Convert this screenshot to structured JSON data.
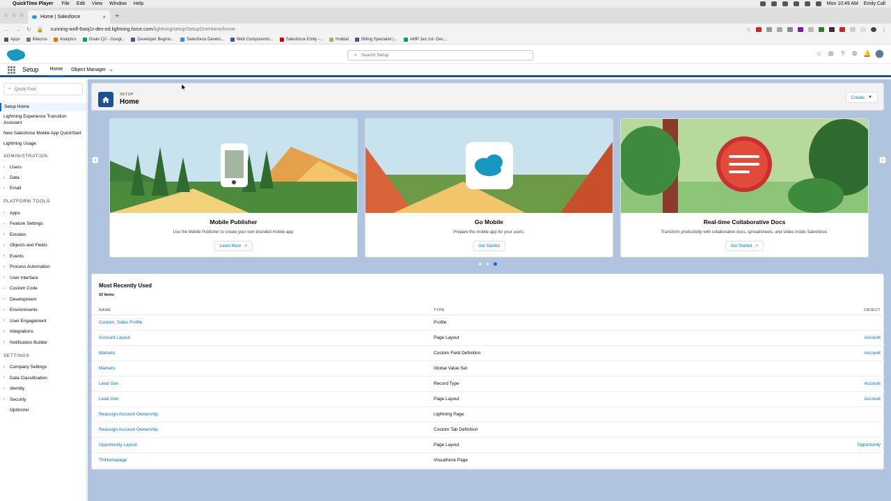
{
  "menubar": {
    "app_name": "QuickTime Player",
    "menus": [
      "File",
      "Edit",
      "View",
      "Window",
      "Help"
    ],
    "clock": "Mon 10:49 AM",
    "user": "Emily Call"
  },
  "browser": {
    "tab_title": "Home | Salesforce",
    "url_host": "cunning-wolf-6woj1r-dev-ed.lightning.force.com",
    "url_path": "/lightning/setup/SetupOneHome/home",
    "bookmarks": [
      {
        "label": "Apps",
        "color": "#555555"
      },
      {
        "label": "iMacros",
        "color": "#777777"
      },
      {
        "label": "Analytics",
        "color": "#e37400"
      },
      {
        "label": "Goals Q2 - Googl...",
        "color": "#0f9d58"
      },
      {
        "label": "Developer Beginn...",
        "color": "#3b5998"
      },
      {
        "label": "Salesforce Develo...",
        "color": "#4285f4"
      },
      {
        "label": "Web Components...",
        "color": "#3b5998"
      },
      {
        "label": "Salesforce Emily -...",
        "color": "#cc0000"
      },
      {
        "label": "Hubitat",
        "color": "#8bc34a"
      },
      {
        "label": "Billing Specialist |...",
        "color": "#3b5998"
      },
      {
        "label": "AMP Jan 1st- Dec...",
        "color": "#0f9d58"
      }
    ]
  },
  "sf_header": {
    "search_placeholder": "Search Setup"
  },
  "sf_nav": {
    "app_name": "Setup",
    "tabs": [
      "Home",
      "Object Manager"
    ]
  },
  "sidebar": {
    "quick_find_placeholder": "Quick Find",
    "top_items": [
      "Setup Home",
      "Lightning Experience Transition Assistant",
      "New Salesforce Mobile App QuickStart",
      "Lightning Usage"
    ],
    "sections": [
      {
        "title": "ADMINISTRATION",
        "items": [
          "Users",
          "Data",
          "Email"
        ]
      },
      {
        "title": "PLATFORM TOOLS",
        "items": [
          "Apps",
          "Feature Settings",
          "Einstein",
          "Objects and Fields",
          "Events",
          "Process Automation",
          "User Interface",
          "Custom Code",
          "Development",
          "Environments",
          "User Engagement",
          "Integrations",
          "Notification Builder"
        ]
      },
      {
        "title": "SETTINGS",
        "items": [
          "Company Settings",
          "Data Classification",
          "Identity",
          "Security",
          "Optimizer"
        ]
      }
    ]
  },
  "page_header": {
    "eyebrow": "SETUP",
    "title": "Home",
    "create_label": "Create"
  },
  "carousel": {
    "cards": [
      {
        "title": "Mobile Publisher",
        "description": "Use the Mobile Publisher to create your own branded mobile app.",
        "button": "Learn More"
      },
      {
        "title": "Go Mobile",
        "description": "Prepare the mobile app for your users.",
        "button": "Get Started"
      },
      {
        "title": "Real-time Collaborative Docs",
        "description": "Transform productivity with collaborative docs, spreadsheets, and slides inside Salesforce.",
        "button": "Get Started"
      }
    ],
    "active_page": 3
  },
  "mru": {
    "title": "Most Recently Used",
    "count": "10 items",
    "columns": [
      "NAME",
      "TYPE",
      "OBJECT"
    ],
    "rows": [
      {
        "name": "Custom: Sales Profile",
        "type": "Profile",
        "object": ""
      },
      {
        "name": "Account Layout",
        "type": "Page Layout",
        "object": "Account"
      },
      {
        "name": "Markets",
        "type": "Custom Field Definition",
        "object": "Account"
      },
      {
        "name": "Markets",
        "type": "Global Value Set",
        "object": ""
      },
      {
        "name": "Lead Gen",
        "type": "Record Type",
        "object": "Account"
      },
      {
        "name": "Lead Gen",
        "type": "Page Layout",
        "object": "Account"
      },
      {
        "name": "Reassign Account Ownership",
        "type": "Lightning Page",
        "object": ""
      },
      {
        "name": "Reassign Account Ownership",
        "type": "Custom Tab Definition",
        "object": ""
      },
      {
        "name": "Opportunity Layout",
        "type": "Page Layout",
        "object": "Opportunity"
      },
      {
        "name": "THHomepage",
        "type": "Visualforce Page",
        "object": ""
      }
    ]
  },
  "colors": {
    "brand_blue": "#0070d2",
    "nav_blue": "#1b5297",
    "page_bg": "#b0c4df"
  }
}
